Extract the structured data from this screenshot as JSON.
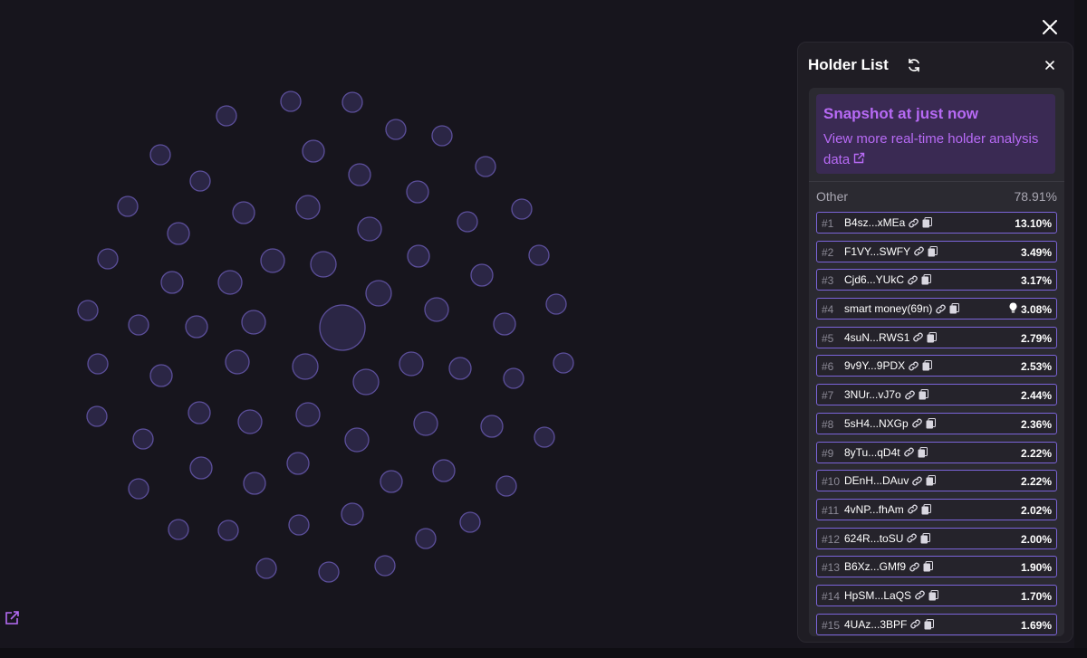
{
  "panel": {
    "title": "Holder List",
    "snapshot_title": "Snapshot at just now",
    "snapshot_link": "View more real-time holder analysis data",
    "other_label": "Other",
    "other_percent": "78.91%"
  },
  "holders": [
    {
      "rank": "#1",
      "address": "B4sz...xMEa",
      "percent": "13.10%"
    },
    {
      "rank": "#2",
      "address": "F1VY...SWFY",
      "percent": "3.49%"
    },
    {
      "rank": "#3",
      "address": "Cjd6...YUkC",
      "percent": "3.17%"
    },
    {
      "rank": "#4",
      "address": "smart money(69n)",
      "percent": "3.08%",
      "smart": true
    },
    {
      "rank": "#5",
      "address": "4suN...RWS1",
      "percent": "2.79%"
    },
    {
      "rank": "#6",
      "address": "9v9Y...9PDX",
      "percent": "2.53%"
    },
    {
      "rank": "#7",
      "address": "3NUr...vJ7o",
      "percent": "2.44%"
    },
    {
      "rank": "#8",
      "address": "5sH4...NXGp",
      "percent": "2.36%"
    },
    {
      "rank": "#9",
      "address": "8yTu...qD4t",
      "percent": "2.22%"
    },
    {
      "rank": "#10",
      "address": "DEnH...DAuv",
      "percent": "2.22%"
    },
    {
      "rank": "#11",
      "address": "4vNP...fhAm",
      "percent": "2.02%"
    },
    {
      "rank": "#12",
      "address": "624R...toSU",
      "percent": "2.00%"
    },
    {
      "rank": "#13",
      "address": "B6Xz...GMf9",
      "percent": "1.90%"
    },
    {
      "rank": "#14",
      "address": "HpSM...LaQS",
      "percent": "1.70%"
    },
    {
      "rank": "#15",
      "address": "4UAz...3BPF",
      "percent": "1.69%"
    }
  ],
  "icons": {
    "modal_close": "close-icon",
    "refresh": "refresh-icon",
    "link": "link-icon",
    "copy": "copy-icon",
    "external": "external-link-icon",
    "smart_money": "lightbulb-icon"
  },
  "colors": {
    "accent": "#b76af5",
    "bubble_fill": "#2b2645",
    "bubble_stroke": "#5c4f9b",
    "row_border": "#7b64d8"
  }
}
